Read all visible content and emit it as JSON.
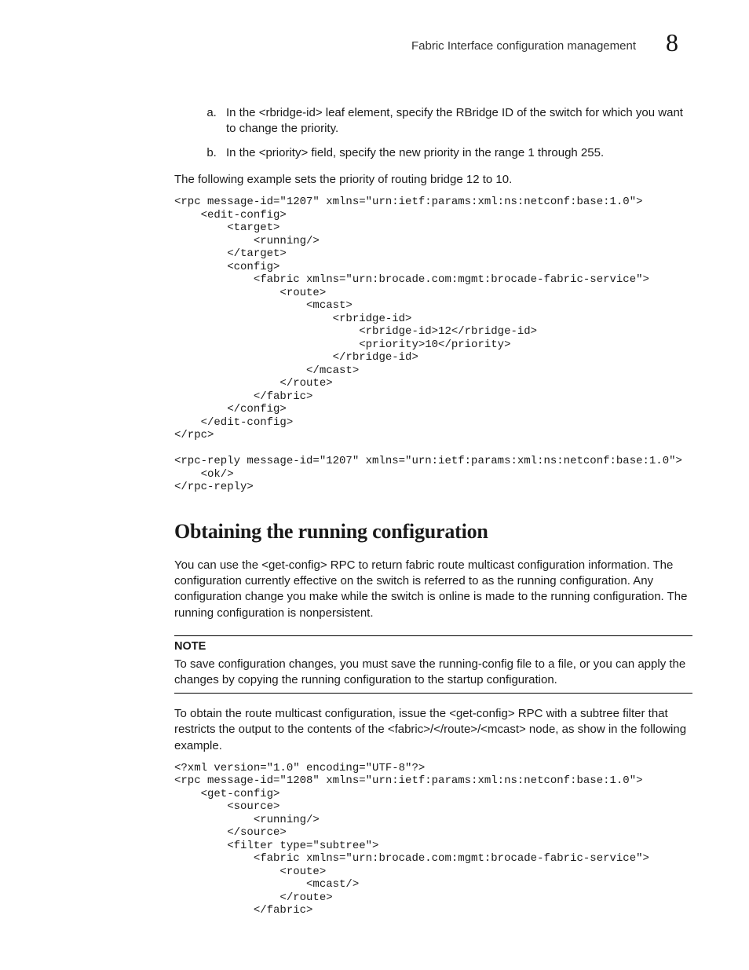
{
  "header": {
    "title": "Fabric Interface configuration management",
    "chapter": "8"
  },
  "steps": [
    "In the <rbridge-id> leaf element, specify the RBridge ID of the switch for which you want to change the priority.",
    "In the <priority> field, specify the new priority in the range 1 through 255."
  ],
  "intro_after_steps": "The following example sets the priority of routing bridge 12 to 10.",
  "code1": "<rpc message-id=\"1207\" xmlns=\"urn:ietf:params:xml:ns:netconf:base:1.0\">\n    <edit-config>\n        <target>\n            <running/>\n        </target>\n        <config>\n            <fabric xmlns=\"urn:brocade.com:mgmt:brocade-fabric-service\">\n                <route>\n                    <mcast>\n                        <rbridge-id>\n                            <rbridge-id>12</rbridge-id>\n                            <priority>10</priority>\n                        </rbridge-id>\n                    </mcast>\n                </route>\n            </fabric>\n        </config>\n    </edit-config>\n</rpc>\n\n<rpc-reply message-id=\"1207\" xmlns=\"urn:ietf:params:xml:ns:netconf:base:1.0\">\n    <ok/>\n</rpc-reply>",
  "section_heading": "Obtaining the running configuration",
  "section_p1": "You can use the <get-config> RPC to return fabric route multicast configuration information. The configuration currently effective on the switch is referred to as the running configuration. Any configuration change you make while the switch is online is made to the running configuration. The running configuration is nonpersistent.",
  "note": {
    "label": "NOTE",
    "text": "To save configuration changes, you must save the running-config file to a file, or you can apply the changes by copying the running configuration to the startup configuration."
  },
  "section_p2": "To obtain the route multicast configuration, issue the <get-config> RPC with a subtree filter that restricts the output to the contents of the <fabric>/</route>/<mcast> node, as show in the following example.",
  "code2": "<?xml version=\"1.0\" encoding=\"UTF-8\"?>\n<rpc message-id=\"1208\" xmlns=\"urn:ietf:params:xml:ns:netconf:base:1.0\">\n    <get-config>\n        <source>\n            <running/>\n        </source>\n        <filter type=\"subtree\">\n            <fabric xmlns=\"urn:brocade.com:mgmt:brocade-fabric-service\">\n                <route>\n                    <mcast/>\n                </route>\n            </fabric>"
}
